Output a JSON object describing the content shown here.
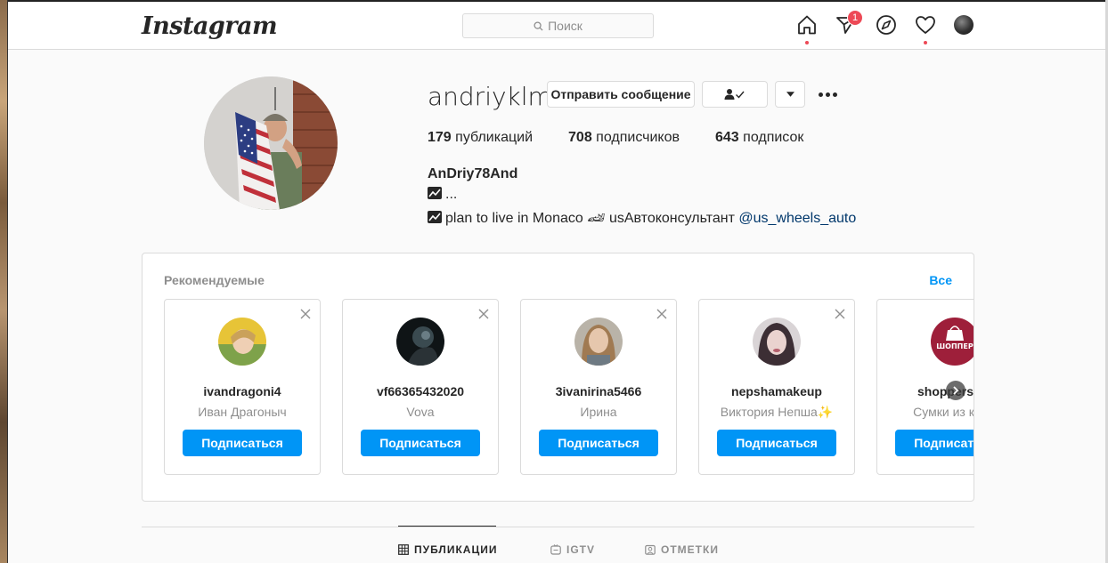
{
  "header": {
    "logo": "Instagram",
    "search_placeholder": "Поиск",
    "direct_badge": "1"
  },
  "profile": {
    "username": "andriyklm",
    "message_button": "Отправить сообщение",
    "stats": [
      {
        "count": "179",
        "label": "публикаций"
      },
      {
        "count": "708",
        "label": "подписчиков"
      },
      {
        "count": "643",
        "label": "подписок"
      }
    ],
    "full_name": "AnDriy78And",
    "bio_line1": "...",
    "bio_line2_text": "plan to live in Monaco 🏎 usАвтоконсультант ",
    "bio_line2_mention": "@us_wheels_auto"
  },
  "suggestions": {
    "title": "Рекомендуемые",
    "see_all": "Все",
    "cards": [
      {
        "username": "ivandragoni4",
        "subtitle": "Иван Драгоныч",
        "button": "Подписаться"
      },
      {
        "username": "vf66365432020",
        "subtitle": "Vova",
        "button": "Подписаться"
      },
      {
        "username": "3ivanirina5466",
        "subtitle": "Ирина",
        "button": "Подписаться"
      },
      {
        "username": "nepshamakeup",
        "subtitle": "Виктория Непша✨",
        "button": "Подписаться"
      },
      {
        "username": "shoppersum",
        "subtitle": "Сумки из кожи",
        "button": "Подписаться",
        "avatar_text": "ШОППЕР"
      }
    ]
  },
  "tabs": [
    {
      "label": "ПУБЛИКАЦИИ",
      "icon": "grid-icon",
      "active": true
    },
    {
      "label": "IGTV",
      "icon": "igtv-icon",
      "active": false
    },
    {
      "label": "ОТМЕТКИ",
      "icon": "tagged-icon",
      "active": false
    }
  ]
}
